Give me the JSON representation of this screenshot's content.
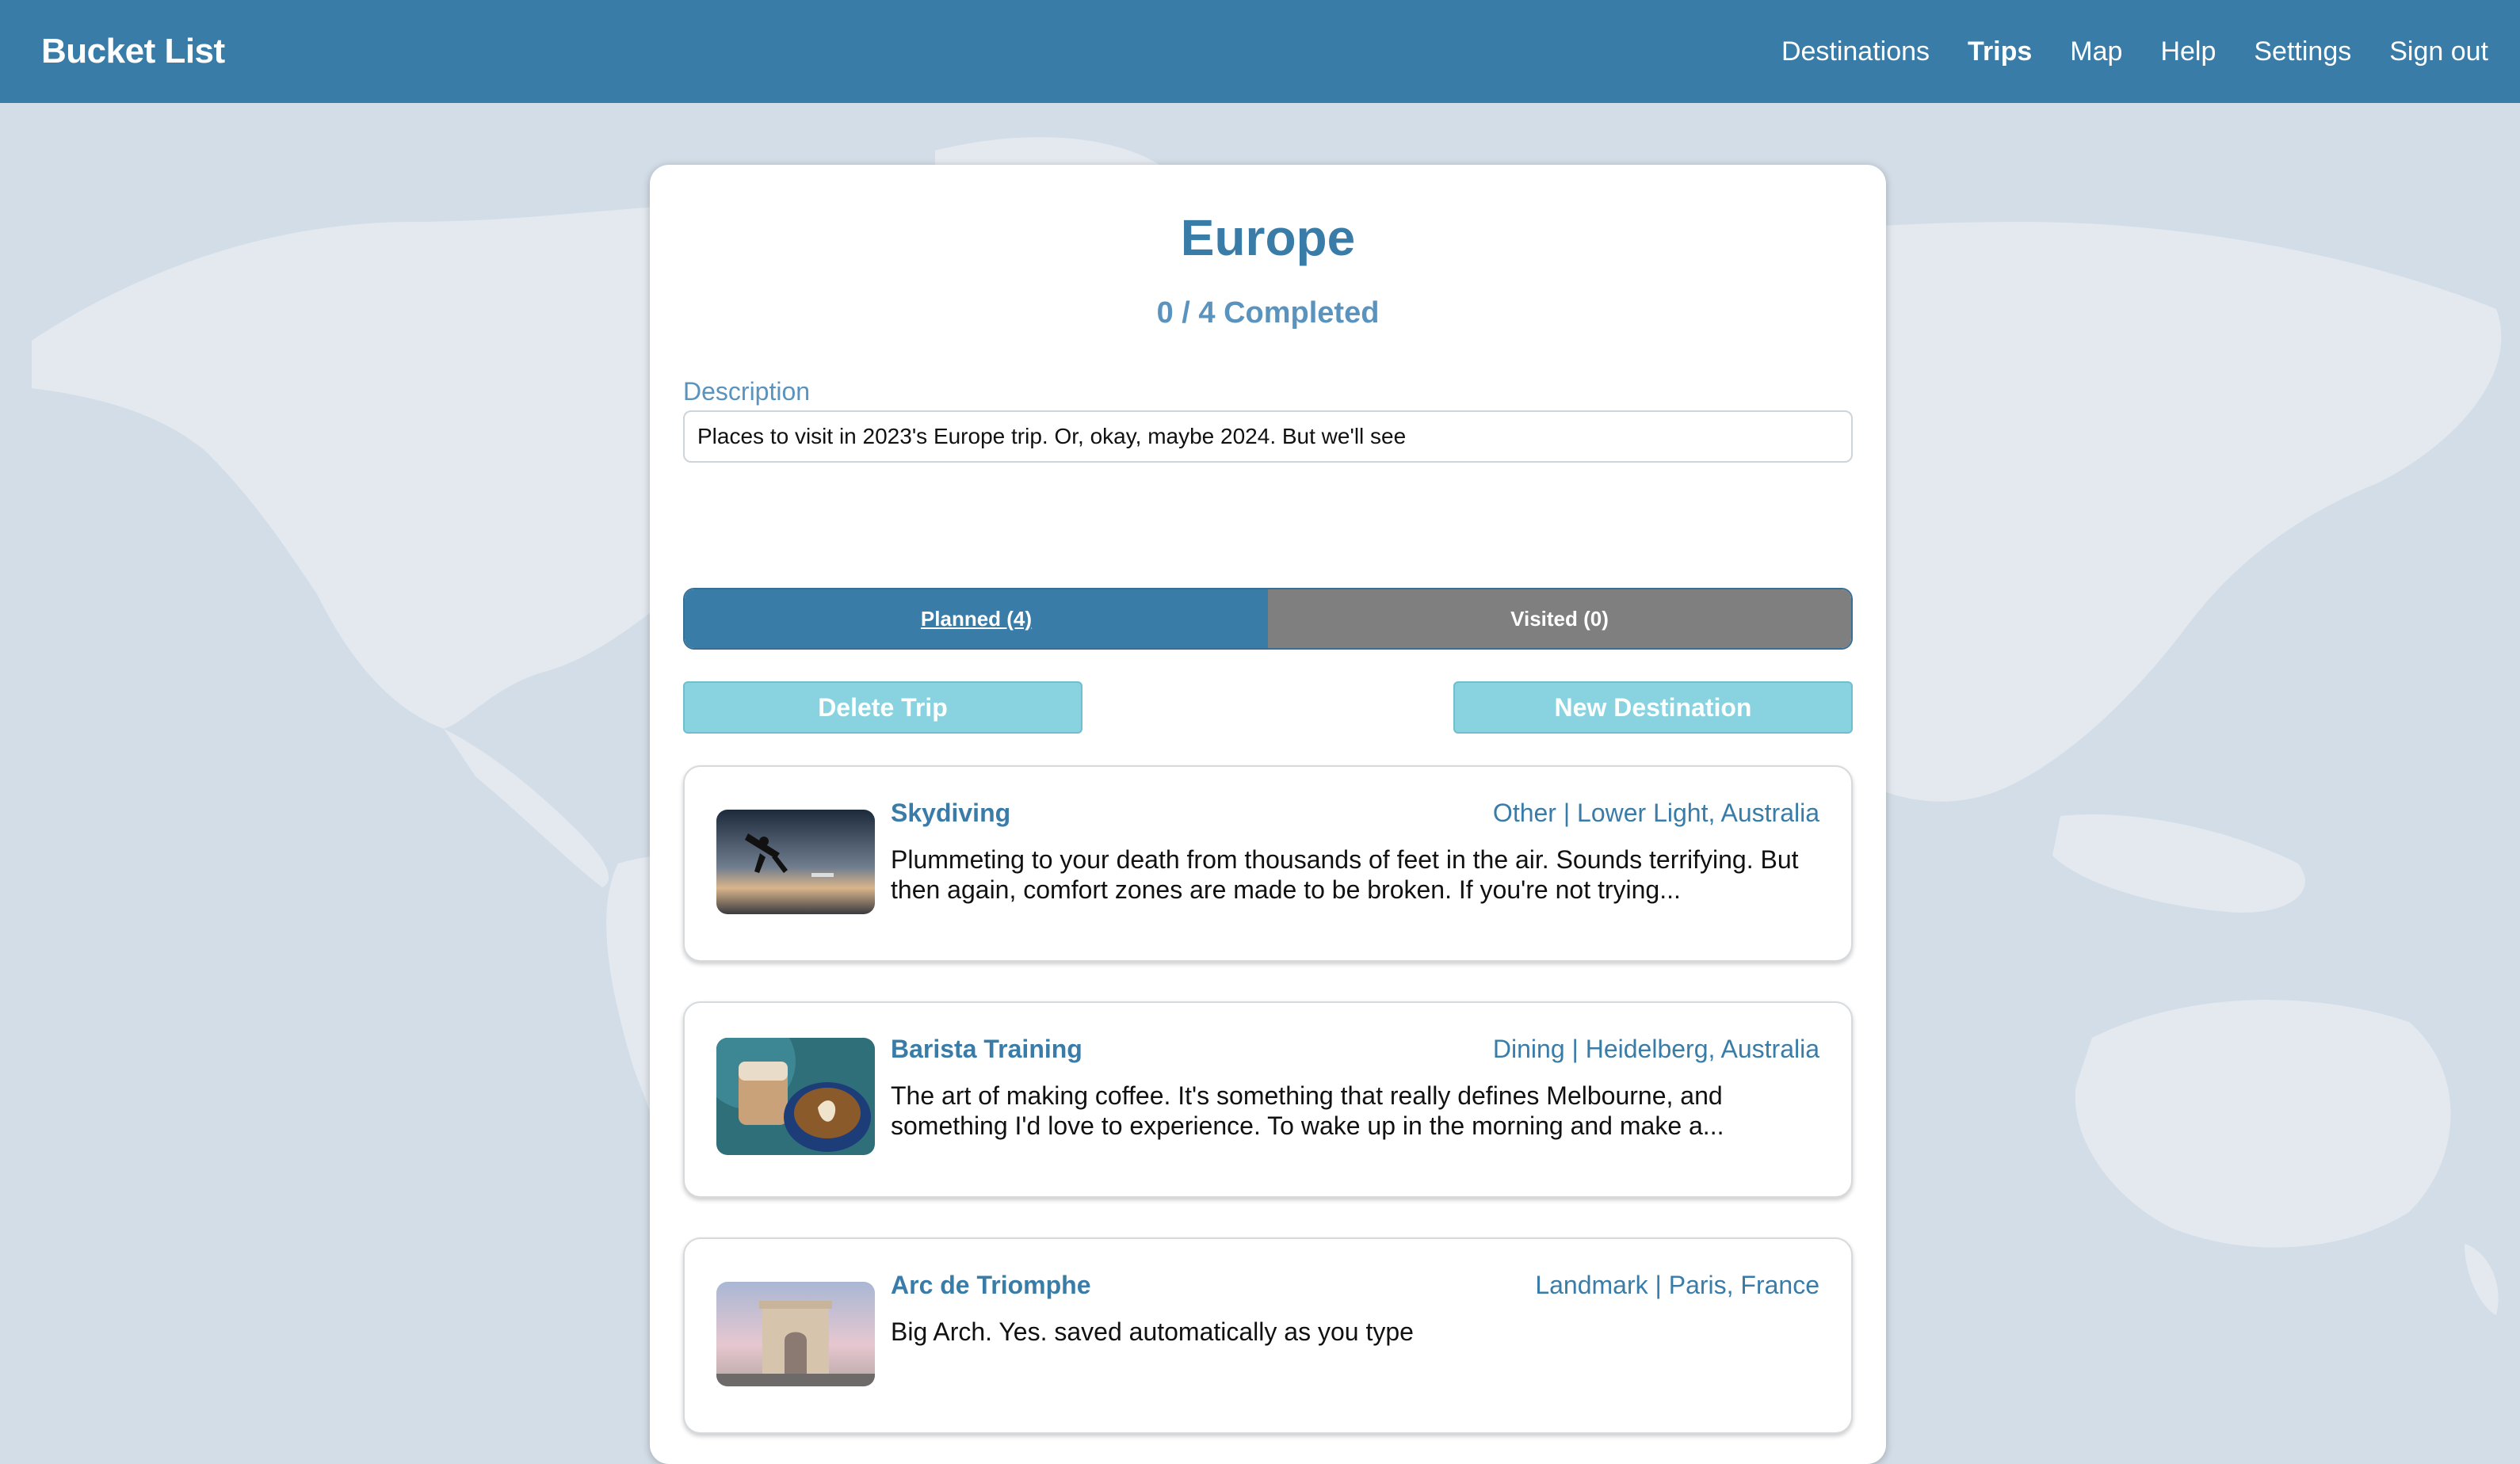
{
  "app": {
    "brand": "Bucket List"
  },
  "nav": [
    {
      "label": "Destinations",
      "active": false
    },
    {
      "label": "Trips",
      "active": true
    },
    {
      "label": "Map",
      "active": false
    },
    {
      "label": "Help",
      "active": false
    },
    {
      "label": "Settings",
      "active": false
    },
    {
      "label": "Sign out",
      "active": false
    }
  ],
  "trip": {
    "title": "Europe",
    "progress": "0 / 4 Completed",
    "description_label": "Description",
    "description_value": "Places to visit in 2023's Europe trip. Or, okay, maybe 2024. But we'll see"
  },
  "tabs": [
    {
      "label": "Planned (4)",
      "selected": true
    },
    {
      "label": "Visited (0)",
      "selected": false
    }
  ],
  "actions": {
    "delete": "Delete Trip",
    "new": "New Destination"
  },
  "destinations": [
    {
      "name": "Skydiving",
      "meta": "Other | Lower Light, Australia",
      "description": "Plummeting to your death from thousands of feet in the air. Sounds terrifying. But then again, comfort zones are made to be broken. If you're not trying..."
    },
    {
      "name": "Barista Training",
      "meta": "Dining | Heidelberg, Australia",
      "description": "The art of making coffee. It's something that really defines Melbourne, and something I'd love to experience. To wake up in the morning and make a..."
    },
    {
      "name": "Arc de Triomphe",
      "meta": "Landmark | Paris, France",
      "description": "Big Arch. Yes. saved automatically as you type"
    }
  ],
  "colors": {
    "primary": "#3a7ca8",
    "accent": "#89d3e0",
    "muted": "#7f7f7f",
    "background": "#d3dde7"
  }
}
